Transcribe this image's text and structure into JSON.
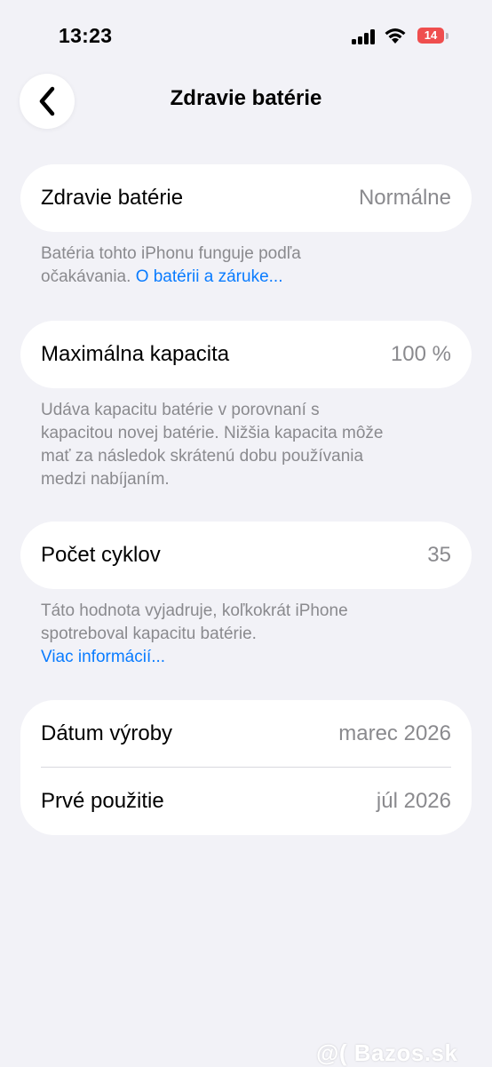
{
  "status_bar": {
    "time": "13:23",
    "battery_level": "14",
    "battery_color": "#ef4e4e"
  },
  "header": {
    "title": "Zdravie batérie"
  },
  "battery_health": {
    "label": "Zdravie batérie",
    "value": "Normálne",
    "footer": "Batéria tohto iPhonu funguje podľa očakávania.",
    "footer_link": "O batérii a záruke..."
  },
  "max_capacity": {
    "label": "Maximálna kapacita",
    "value": "100 %",
    "footer": "Udáva kapacitu batérie v porovnaní s kapacitou novej batérie. Nižšia kapacita môže mať za následok skrátenú dobu používania medzi nabíjaním."
  },
  "cycle_count": {
    "label": "Počet cyklov",
    "value": "35",
    "footer": "Táto hodnota vyjadruje, koľkokrát iPhone spotreboval kapacitu batérie.",
    "footer_link": "Viac informácií..."
  },
  "dates": {
    "manufacture_label": "Dátum výroby",
    "manufacture_value": "marec 2026",
    "first_use_label": "Prvé použitie",
    "first_use_value": "júl 2026"
  },
  "watermark": "@( Bazos.sk",
  "colors": {
    "background": "#f2f2f7",
    "link": "#0a7cff",
    "secondary_text": "#8a8a8e"
  }
}
